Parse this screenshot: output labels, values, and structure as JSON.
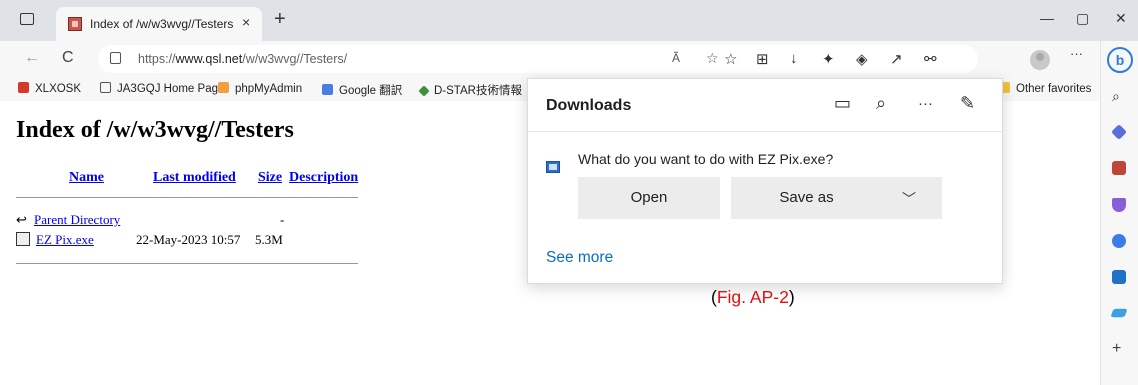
{
  "tab": {
    "title": "Index of /w/w3wvg//Testers",
    "close": "×",
    "new_tab": "+"
  },
  "window": {
    "minimize": "—",
    "maximize": "▢",
    "close": "✕"
  },
  "toolbar": {
    "back": "←",
    "refresh": "C",
    "url_prefix": "https://",
    "url_host": "www.qsl.net",
    "url_path": "/w/w3wvg//Testers/",
    "read_aloud": "Ã",
    "more": "···"
  },
  "favorites": [
    {
      "label": "XLXOSK",
      "color": "#d23a2a"
    },
    {
      "label": "JA3GQJ Home Page",
      "color": "#ffffff"
    },
    {
      "label": "phpMyAdmin",
      "color": "#f0a040"
    },
    {
      "label": "Google 翻訳",
      "color": "#4a7de0"
    },
    {
      "label": "D-STAR技術情報",
      "color": "#3f8f3f"
    },
    {
      "label": "Other favorites",
      "color": "#f2c43a"
    }
  ],
  "page": {
    "heading": "Index of /w/w3wvg//Testers",
    "columns": [
      "Name",
      "Last modified",
      "Size",
      "Description"
    ],
    "rows": [
      {
        "name": "Parent Directory",
        "modified": "",
        "size": "-"
      },
      {
        "name": "EZ Pix.exe",
        "modified": "22-May-2023 10:57",
        "size": "5.3M"
      }
    ]
  },
  "downloads": {
    "title": "Downloads",
    "question": "What do you want to do with EZ Pix.exe?",
    "open_label": "Open",
    "save_as_label": "Save as",
    "see_more": "See more",
    "more": "···"
  },
  "caption": {
    "open": "(",
    "text": "Fig. AP-2",
    "close": ")"
  }
}
